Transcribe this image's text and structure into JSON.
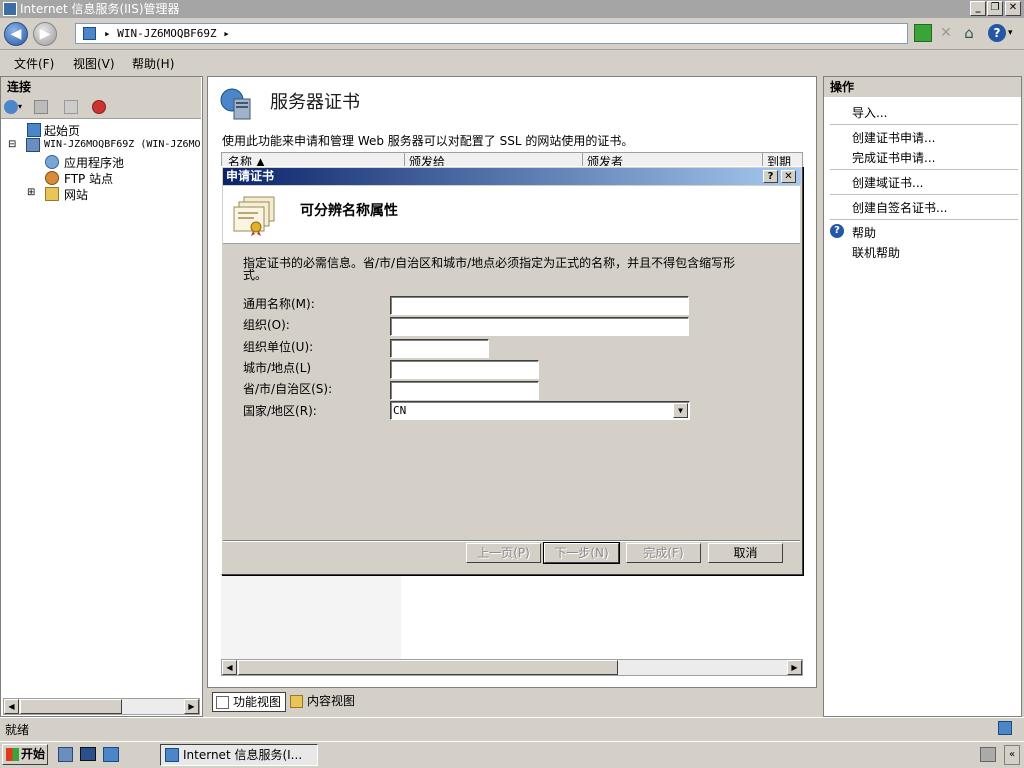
{
  "window": {
    "title": "Internet 信息服务(IIS)管理器"
  },
  "address": {
    "path": "WIN-JZ6MOQBF69Z",
    "separator": "▸"
  },
  "menu": [
    "文件(F)",
    "视图(V)",
    "帮助(H)"
  ],
  "left": {
    "header": "连接",
    "tree": [
      {
        "label": "起始页",
        "icon": "start-page-icon"
      },
      {
        "label": "WIN-JZ6MOQBF69Z (WIN-JZ6MO",
        "icon": "server-icon",
        "expander": "⊟"
      },
      {
        "label": "应用程序池",
        "icon": "app-pool-icon"
      },
      {
        "label": "FTP 站点",
        "icon": "ftp-site-icon"
      },
      {
        "label": "网站",
        "icon": "website-folder-icon",
        "expander": "⊞"
      }
    ]
  },
  "center": {
    "title": "服务器证书",
    "description": "使用此功能来申请和管理 Web 服务器可以对配置了 SSL 的网站使用的证书。",
    "columns": [
      "名称 ▲",
      "颁发给",
      "颁发者",
      "到期日"
    ],
    "view_tabs": [
      "功能视图",
      "内容视图"
    ]
  },
  "dialog": {
    "title": "申请证书",
    "help_btn": "?",
    "close_btn": "✕",
    "heading": "可分辨名称属性",
    "instruction": "指定证书的必需信息。省/市/自治区和城市/地点必须指定为正式的名称，并且不得包含缩写形式。",
    "fields": [
      {
        "label": "通用名称(M):",
        "value": ""
      },
      {
        "label": "组织(O):",
        "value": ""
      },
      {
        "label": "组织单位(U):",
        "value": ""
      },
      {
        "label": "城市/地点(L)",
        "value": ""
      },
      {
        "label": "省/市/自治区(S):",
        "value": ""
      },
      {
        "label": "国家/地区(R):",
        "value": "CN"
      }
    ],
    "buttons": {
      "prev": "上一页(P)",
      "next": "下一步(N)",
      "finish": "完成(F)",
      "cancel": "取消"
    }
  },
  "actions": {
    "header": "操作",
    "items": [
      "导入...",
      "创建证书申请...",
      "完成证书申请...",
      "创建域证书...",
      "创建自签名证书...",
      "帮助",
      "联机帮助"
    ]
  },
  "status": {
    "text": "就绪"
  },
  "taskbar": {
    "start": "开始",
    "task": "Internet 信息服务(I..."
  },
  "colors": {
    "title_active_start": "#0a246a",
    "title_active_end": "#a6caf0",
    "inactive_title": "#a5a5a5"
  }
}
